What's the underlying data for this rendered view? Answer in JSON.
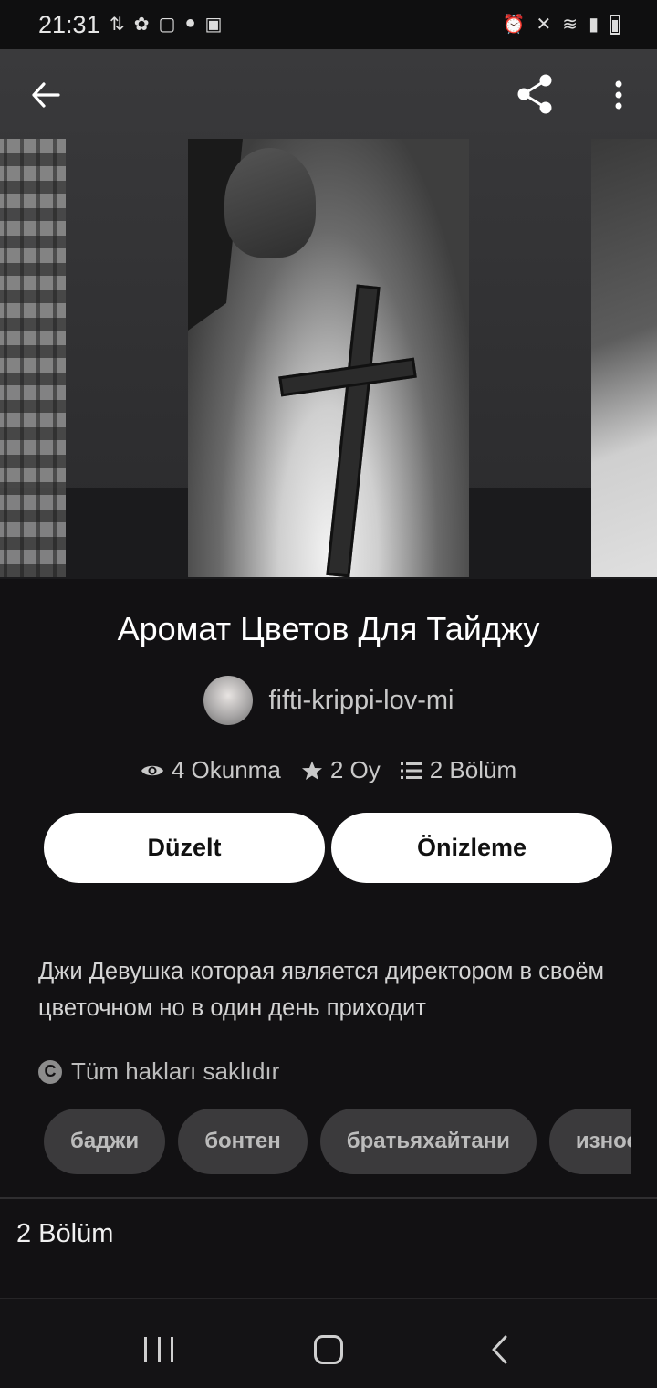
{
  "status_bar": {
    "time": "21:31",
    "left_icons": [
      "data-speed-icon",
      "pet-icon",
      "square-icon",
      "cat-icon",
      "image-icon"
    ],
    "right_icons": [
      "alarm-icon",
      "mute-icon",
      "wifi-icon",
      "signal-icon",
      "battery-icon"
    ]
  },
  "story": {
    "title": "Аромат Цветов Для Тайджу",
    "author": "fifti-krippi-lov-mi",
    "stats": {
      "reads": "4 Okunma",
      "votes": "2 Oy",
      "parts": "2 Bölüm"
    },
    "buttons": {
      "edit": "Düzelt",
      "preview": "Önizleme"
    },
    "description": "Джи Девушка которая является директором в своём цветочном но в один день приходит",
    "copyright": "Tüm hakları saklıdır",
    "copyright_symbol": "C",
    "tags": [
      "баджи",
      "бонтен",
      "братьяхайтани",
      "износ"
    ],
    "chapters_heading": "2 Bölüm"
  },
  "colors": {
    "background": "#121113",
    "button_bg": "#ffffff",
    "tag_bg": "#3b3a3c"
  }
}
